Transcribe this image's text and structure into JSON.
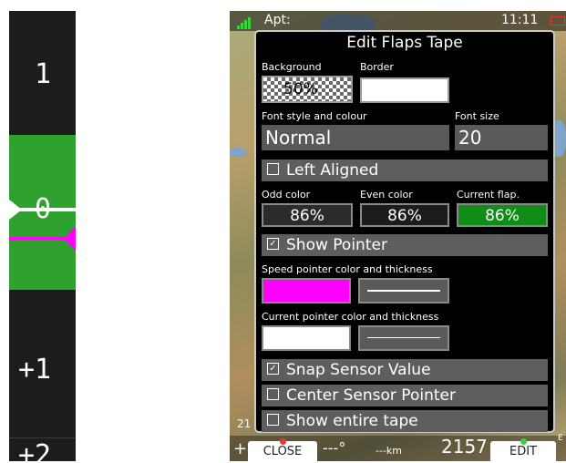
{
  "tape": {
    "labels": {
      "upper": "1",
      "current": "0",
      "lower": "+1",
      "bottom": "+2"
    },
    "colors": {
      "odd": "#1c1c1c",
      "even": "#1c1c1c",
      "current": "#2ea12e",
      "speed_pointer": "#ff00ff",
      "current_pointer": "#ffffff"
    }
  },
  "statusbar": {
    "airport_label": "Apt:",
    "clock": "11:11"
  },
  "dialog": {
    "title": "Edit Flaps Tape",
    "background_label": "Background",
    "background_value": "50%",
    "border_label": "Border",
    "font_style_label": "Font style and colour",
    "font_style_value": "Normal",
    "font_size_label": "Font size",
    "font_size_value": "20",
    "left_aligned_label": "Left Aligned",
    "left_aligned_checked": false,
    "odd_color_label": "Odd color",
    "odd_color_value": "86%",
    "even_color_label": "Even color",
    "even_color_value": "86%",
    "current_flap_label": "Current flap.",
    "current_flap_value": "86%",
    "show_pointer_label": "Show Pointer",
    "show_pointer_checked": true,
    "speed_pointer_label": "Speed pointer color and thickness",
    "current_pointer_label": "Current pointer color and thickness",
    "snap_sensor_label": "Snap Sensor Value",
    "snap_sensor_checked": true,
    "center_sensor_label": "Center Sensor Pointer",
    "center_sensor_checked": false,
    "show_entire_label": "Show entire tape",
    "show_entire_checked": false
  },
  "bottombar": {
    "close_label": "CLOSE",
    "edit_label": "EDIT",
    "left_text": "+",
    "left_digits": "21",
    "degrees_text": "---°",
    "distance_text": "---km",
    "altitude_text": "2157",
    "right_text": "E"
  }
}
